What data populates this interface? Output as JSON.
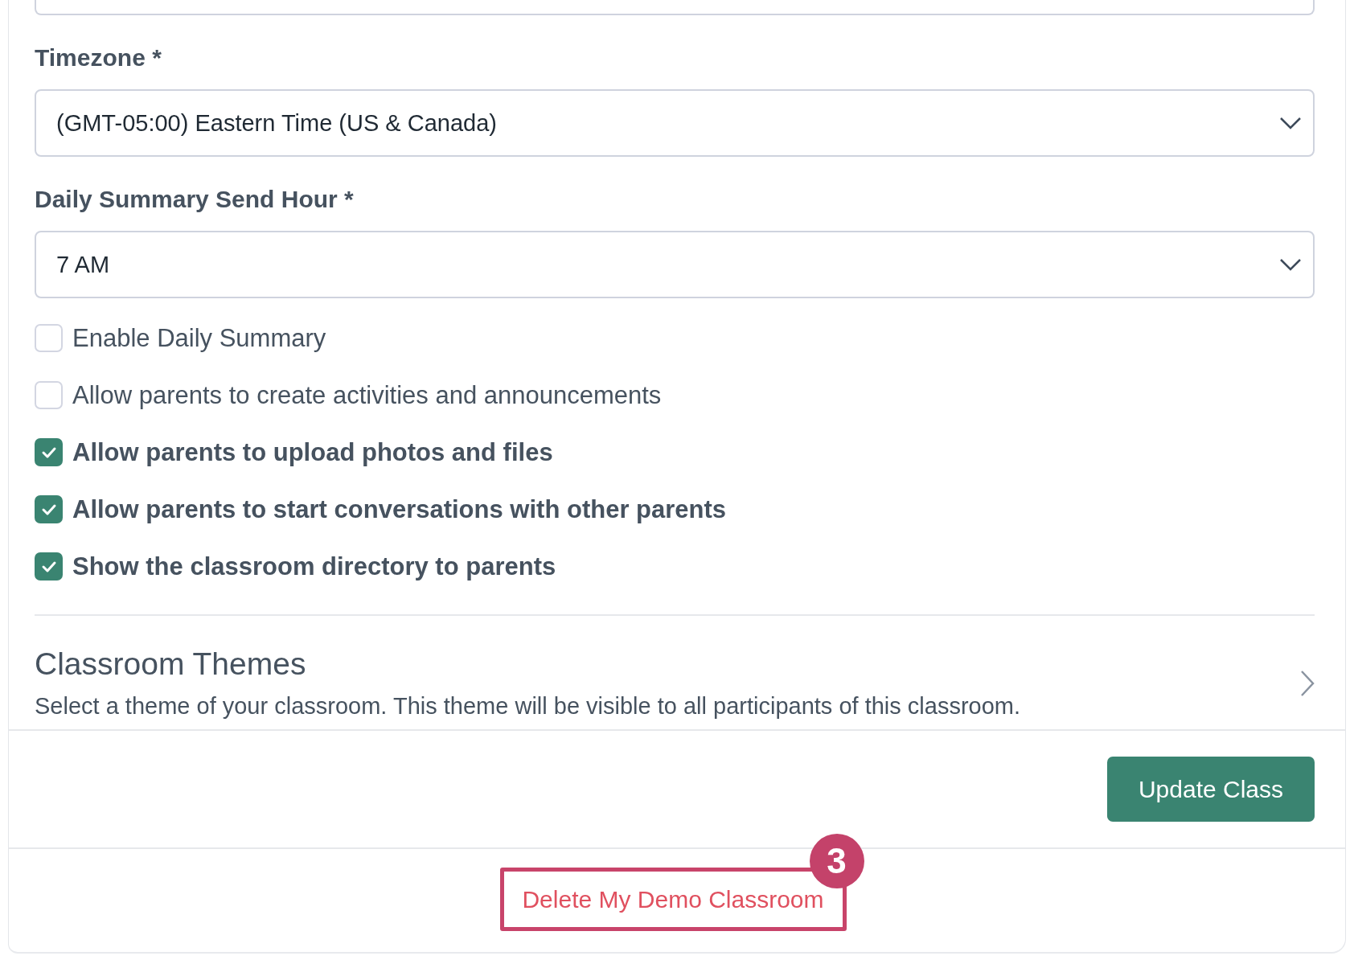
{
  "fields": [
    {
      "label": "Timezone *",
      "value": "(GMT-05:00) Eastern Time (US & Canada)"
    },
    {
      "label": "Daily Summary Send Hour *",
      "value": "7 AM"
    }
  ],
  "options": [
    {
      "label": "Enable Daily Summary",
      "checked": false
    },
    {
      "label": "Allow parents to create activities and announcements",
      "checked": false
    },
    {
      "label": "Allow parents to upload photos and files",
      "checked": true
    },
    {
      "label": "Allow parents to start conversations with other parents",
      "checked": true
    },
    {
      "label": "Show the classroom directory to parents",
      "checked": true
    }
  ],
  "themes": {
    "title": "Classroom Themes",
    "description": "Select a theme of your classroom. This theme will be visible to all participants of this classroom."
  },
  "submit": "Update Class",
  "delete_link": "Delete My Demo Classroom",
  "step_badge": "3"
}
